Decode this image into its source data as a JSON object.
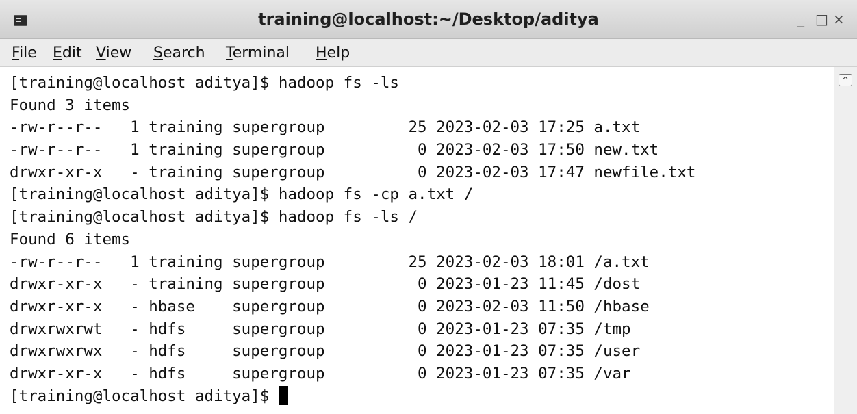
{
  "window": {
    "title": "training@localhost:~/Desktop/aditya",
    "icon": "terminal-icon",
    "controls": {
      "minimize": "_",
      "maximize": "□",
      "close": "×"
    }
  },
  "menu": {
    "items": [
      {
        "label": "File",
        "accel": "F",
        "rest": "ile"
      },
      {
        "label": "Edit",
        "accel": "E",
        "rest": "dit"
      },
      {
        "label": "View",
        "accel": "V",
        "rest": "iew"
      },
      {
        "label": "Search",
        "accel": "S",
        "rest": "earch"
      },
      {
        "label": "Terminal",
        "accel": "T",
        "rest": "erminal"
      },
      {
        "label": "Help",
        "accel": "H",
        "rest": "elp"
      }
    ]
  },
  "terminal": {
    "lines": [
      "[training@localhost aditya]$ hadoop fs -ls",
      "Found 3 items",
      "-rw-r--r--   1 training supergroup         25 2023-02-03 17:25 a.txt",
      "-rw-r--r--   1 training supergroup          0 2023-02-03 17:50 new.txt",
      "drwxr-xr-x   - training supergroup          0 2023-02-03 17:47 newfile.txt",
      "[training@localhost aditya]$ hadoop fs -cp a.txt /",
      "[training@localhost aditya]$ hadoop fs -ls /",
      "Found 6 items",
      "-rw-r--r--   1 training supergroup         25 2023-02-03 18:01 /a.txt",
      "drwxr-xr-x   - training supergroup          0 2023-01-23 11:45 /dost",
      "drwxr-xr-x   - hbase    supergroup          0 2023-02-03 11:50 /hbase",
      "drwxrwxrwt   - hdfs     supergroup          0 2023-01-23 07:35 /tmp",
      "drwxrwxrwx   - hdfs     supergroup          0 2023-01-23 07:35 /user",
      "drwxr-xr-x   - hdfs     supergroup          0 2023-01-23 07:35 /var"
    ],
    "prompt": "[training@localhost aditya]$ "
  },
  "scrollbar": {
    "up_arrow": "^"
  }
}
